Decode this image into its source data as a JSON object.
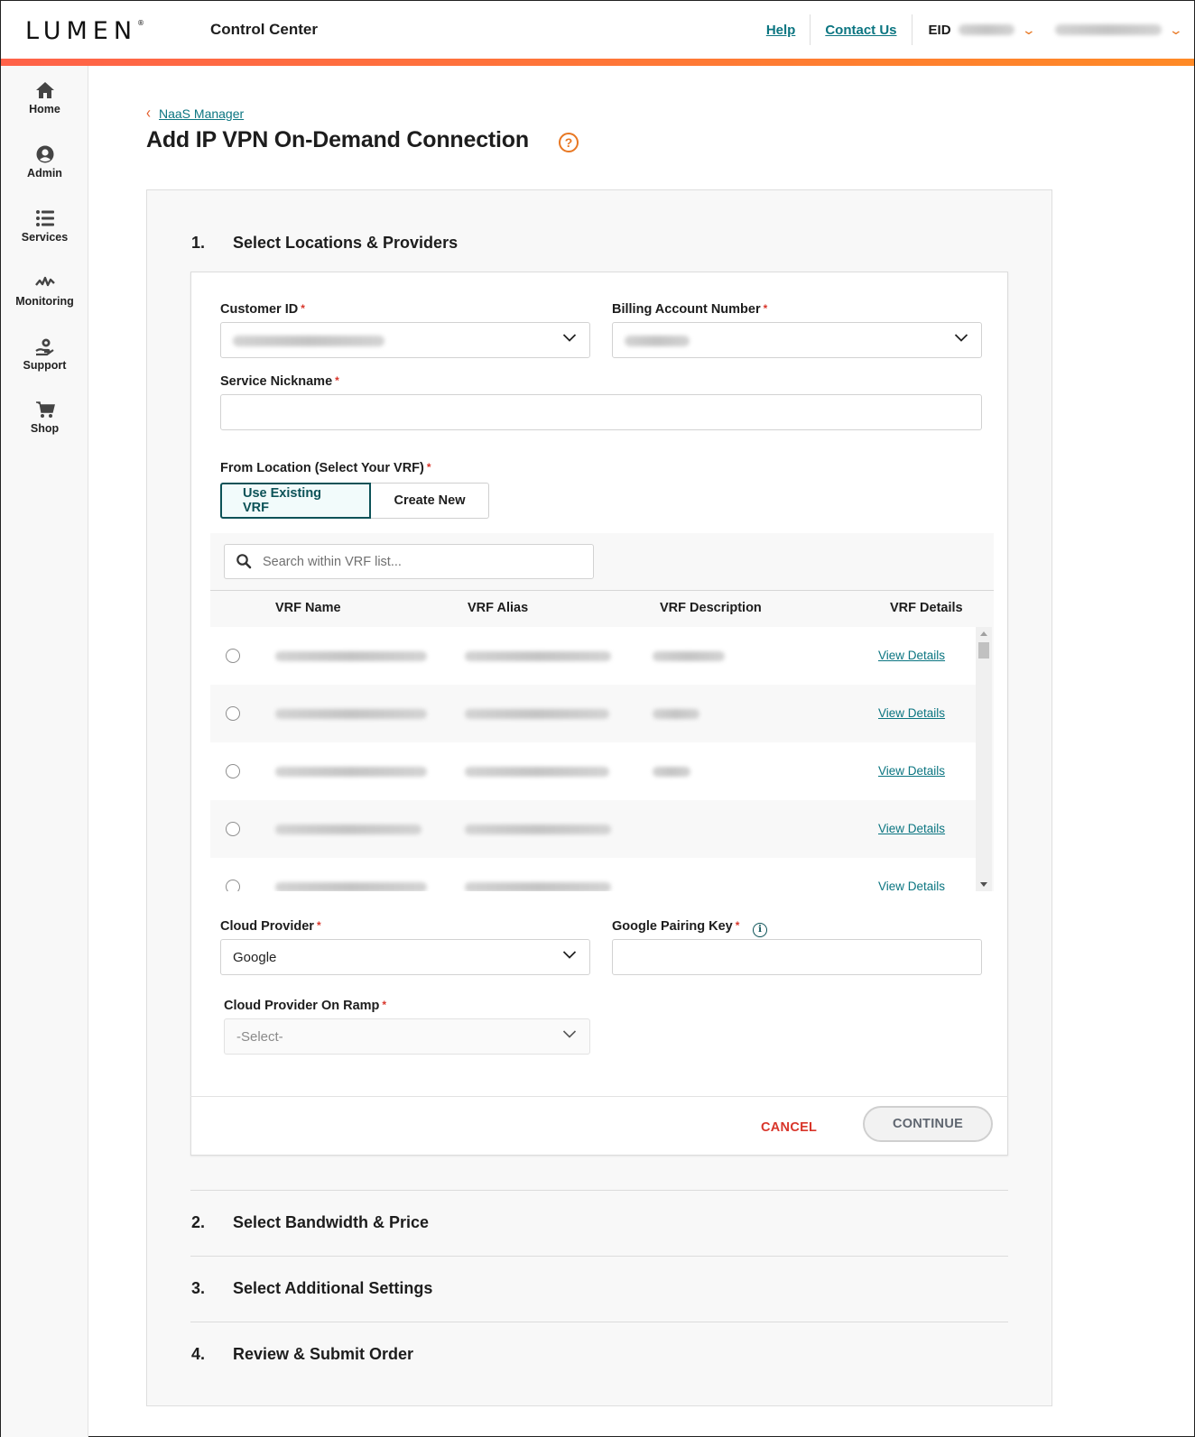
{
  "header": {
    "logo": "LUMEN",
    "app_title": "Control Center",
    "links": [
      "Help",
      "Contact Us"
    ],
    "eid_label": "EID",
    "accent_gradient": [
      "#ff6249",
      "#ff8a26"
    ]
  },
  "sidebar": {
    "items": [
      {
        "label": "Home",
        "icon": "home-icon"
      },
      {
        "label": "Admin",
        "icon": "user-circle-icon"
      },
      {
        "label": "Services",
        "icon": "list-icon"
      },
      {
        "label": "Monitoring",
        "icon": "pulse-icon"
      },
      {
        "label": "Support",
        "icon": "support-hand-gear-icon"
      },
      {
        "label": "Shop",
        "icon": "cart-icon"
      }
    ]
  },
  "breadcrumb": {
    "back_label": "NaaS Manager"
  },
  "page": {
    "title": "Add IP VPN On-Demand Connection",
    "help_icon": "?"
  },
  "steps": [
    {
      "number": "1.",
      "label": "Select Locations & Providers"
    },
    {
      "number": "2.",
      "label": "Select Bandwidth & Price"
    },
    {
      "number": "3.",
      "label": "Select Additional Settings"
    },
    {
      "number": "4.",
      "label": "Review & Submit Order"
    }
  ],
  "form": {
    "customer_id": {
      "label": "Customer ID",
      "required": "*",
      "value": ""
    },
    "billing_account": {
      "label": "Billing Account Number",
      "required": "*",
      "value": ""
    },
    "service_nickname": {
      "label": "Service Nickname",
      "required": "*",
      "value": ""
    },
    "from_location": {
      "label": "From Location (Select Your VRF)",
      "required": "*",
      "options": [
        "Use Existing VRF",
        "Create New"
      ],
      "selected": "Use Existing VRF"
    },
    "vrf_search": {
      "placeholder": "Search within VRF list..."
    },
    "vrf_table": {
      "columns": [
        "VRF Name",
        "VRF Alias",
        "VRF Description",
        "VRF Details"
      ],
      "rows": [
        {
          "link": "View Details"
        },
        {
          "link": "View Details"
        },
        {
          "link": "View Details"
        },
        {
          "link": "View Details"
        },
        {
          "link": "View Details"
        }
      ]
    },
    "cloud_provider": {
      "label": "Cloud Provider",
      "required": "*",
      "value": "Google"
    },
    "pairing_key": {
      "label": "Google Pairing Key",
      "required": "*",
      "value": "",
      "info_icon": "i"
    },
    "on_ramp": {
      "label": "Cloud Provider On Ramp",
      "required": "*",
      "value": "-Select-"
    }
  },
  "actions": {
    "cancel": "CANCEL",
    "continue": "CONTINUE"
  }
}
